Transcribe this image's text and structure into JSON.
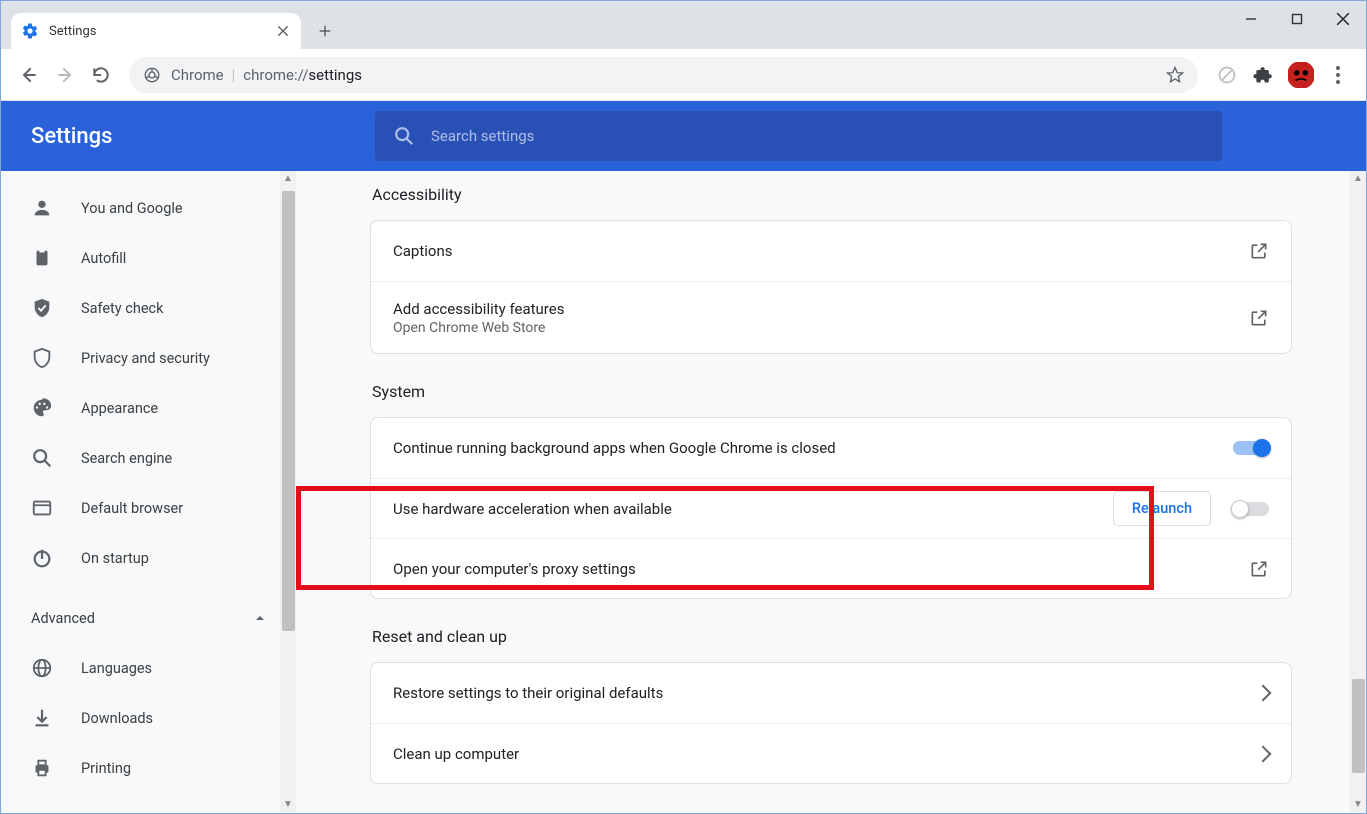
{
  "tab": {
    "title": "Settings"
  },
  "omnibox": {
    "prefix": "Chrome",
    "url_prefix": "chrome://",
    "url_bold": "settings"
  },
  "header": {
    "title": "Settings",
    "search_placeholder": "Search settings"
  },
  "sidebar": {
    "items": [
      {
        "label": "You and Google"
      },
      {
        "label": "Autofill"
      },
      {
        "label": "Safety check"
      },
      {
        "label": "Privacy and security"
      },
      {
        "label": "Appearance"
      },
      {
        "label": "Search engine"
      },
      {
        "label": "Default browser"
      },
      {
        "label": "On startup"
      }
    ],
    "advanced_label": "Advanced",
    "advanced_items": [
      {
        "label": "Languages"
      },
      {
        "label": "Downloads"
      },
      {
        "label": "Printing"
      }
    ]
  },
  "sections": {
    "accessibility": {
      "title": "Accessibility",
      "captions": "Captions",
      "add_features": "Add accessibility features",
      "add_features_sub": "Open Chrome Web Store"
    },
    "system": {
      "title": "System",
      "bg_apps": "Continue running background apps when Google Chrome is closed",
      "hw_accel": "Use hardware acceleration when available",
      "relaunch": "Relaunch",
      "proxy": "Open your computer's proxy settings"
    },
    "reset": {
      "title": "Reset and clean up",
      "restore": "Restore settings to their original defaults",
      "cleanup": "Clean up computer"
    }
  }
}
